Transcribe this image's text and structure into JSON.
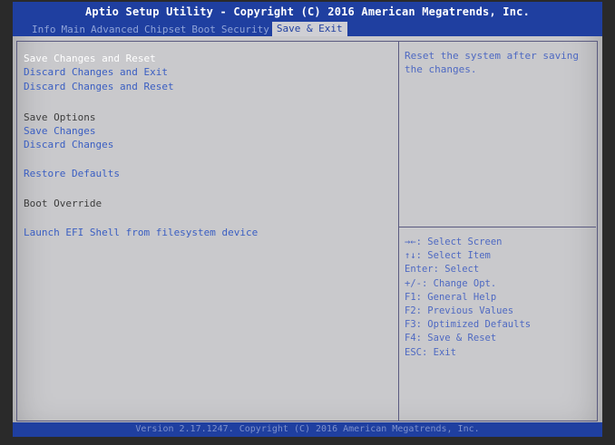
{
  "header": {
    "title": "Aptio Setup Utility - Copyright (C) 2016 American Megatrends, Inc.",
    "tabs": [
      {
        "label": "Info"
      },
      {
        "label": "Main"
      },
      {
        "label": "Advanced"
      },
      {
        "label": "Chipset"
      },
      {
        "label": "Boot"
      },
      {
        "label": "Security"
      },
      {
        "label": "Save & Exit",
        "active": true
      }
    ]
  },
  "menu": {
    "save_changes_and_reset": "Save Changes and Reset",
    "discard_changes_and_exit": "Discard Changes and Exit",
    "discard_changes_and_reset": "Discard Changes and Reset",
    "save_options_heading": "Save Options",
    "save_changes": "Save Changes",
    "discard_changes": "Discard Changes",
    "restore_defaults": "Restore Defaults",
    "boot_override_heading": "Boot Override",
    "launch_efi_shell": "Launch EFI Shell from filesystem device"
  },
  "help_text": "Reset the system after saving the changes.",
  "key_help": [
    {
      "key": "→←:",
      "desc": "Select Screen"
    },
    {
      "key": "↑↓:",
      "desc": "Select Item"
    },
    {
      "key": "Enter:",
      "desc": "Select"
    },
    {
      "key": "+/-:",
      "desc": "Change Opt."
    },
    {
      "key": "F1:",
      "desc": "General Help"
    },
    {
      "key": "F2:",
      "desc": "Previous Values"
    },
    {
      "key": "F3:",
      "desc": "Optimized Defaults"
    },
    {
      "key": "F4:",
      "desc": "Save & Reset"
    },
    {
      "key": "ESC:",
      "desc": "Exit"
    }
  ],
  "footer": "Version 2.17.1247. Copyright (C) 2016 American Megatrends, Inc.",
  "colors": {
    "header_bg": "#1f3fa0",
    "panel_bg": "#c9c9cc",
    "selected_text": "#ffffff",
    "option_text": "#3a5ec2",
    "heading_text": "#3d3d3d"
  }
}
